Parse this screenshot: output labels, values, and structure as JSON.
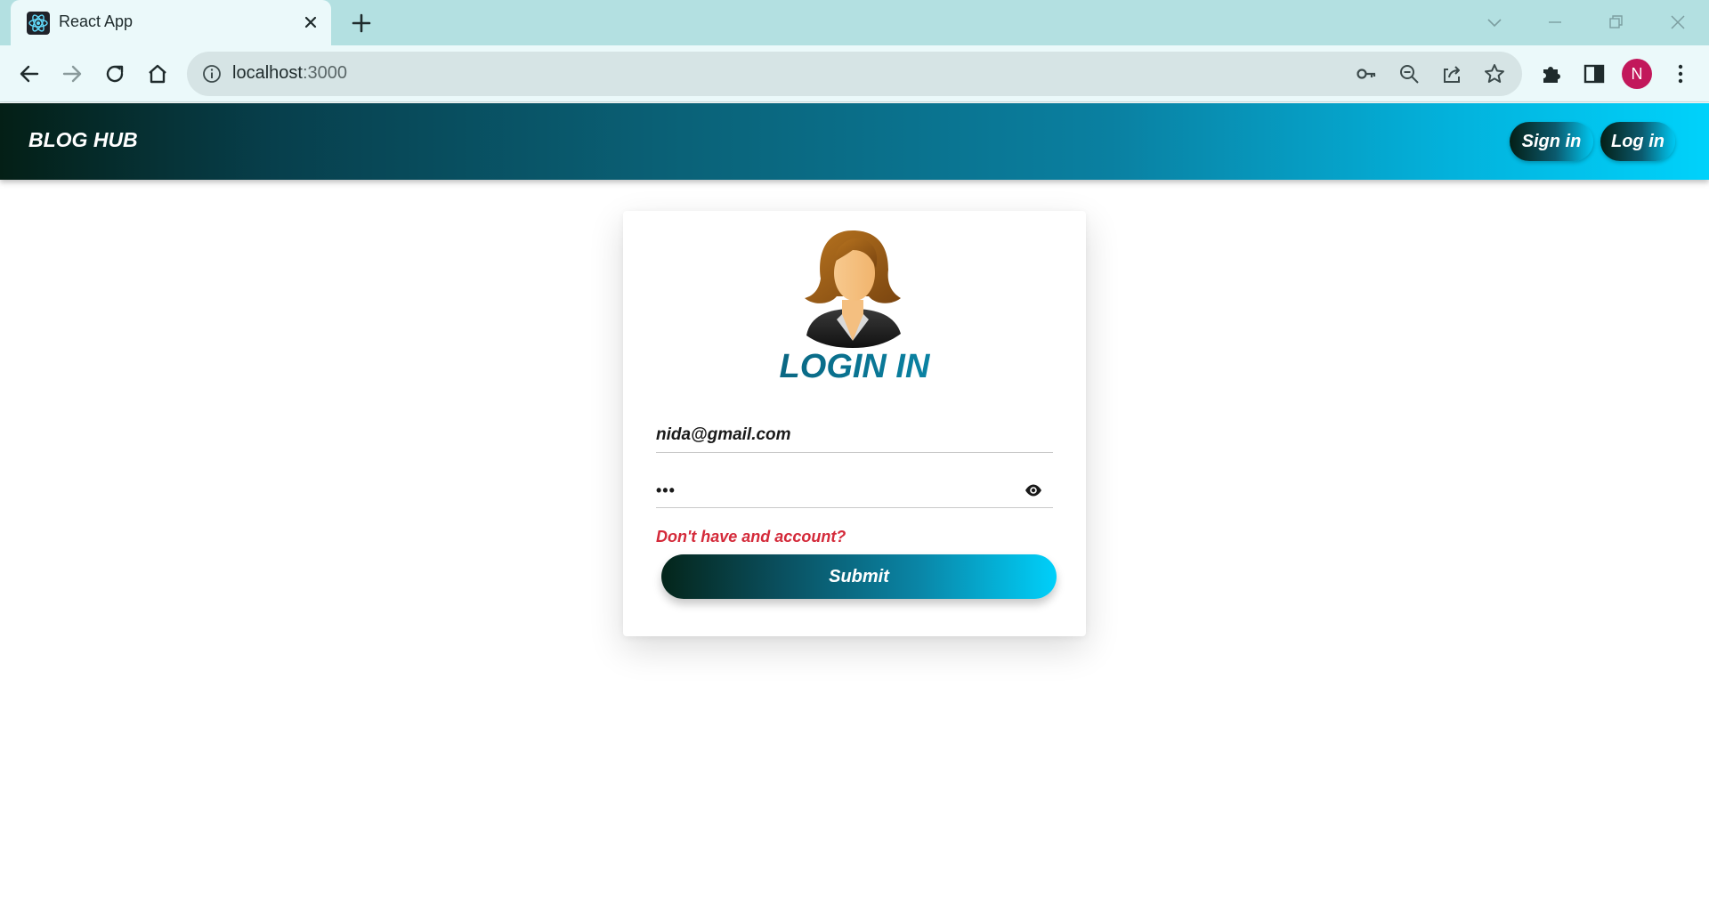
{
  "browser": {
    "tab_title": "React App",
    "url_host": "localhost",
    "url_port": ":3000",
    "profile_initial": "N",
    "profile_color": "#c2185b"
  },
  "app": {
    "brand": "BLOG HUB",
    "nav": {
      "sign_in": "Sign in",
      "log_in": "Log in"
    }
  },
  "login": {
    "title": "LOGIN IN",
    "email_value": "nida@gmail.com",
    "password_value": "•••",
    "signup_link": "Don't have and account?",
    "submit_label": "Submit"
  },
  "colors": {
    "header_gradient_start": "#041f16",
    "header_gradient_end": "#00d2fb",
    "link_red": "#d42a3a",
    "title_teal": "#0a7391"
  },
  "icons": {
    "tab": [
      "react-favicon-icon",
      "close-icon",
      "plus-icon"
    ],
    "window": [
      "chevron-down-icon",
      "minimize-icon",
      "restore-icon",
      "close-window-icon"
    ],
    "toolbar": [
      "back-arrow-icon",
      "forward-arrow-icon",
      "reload-icon",
      "home-icon",
      "info-icon",
      "key-icon",
      "zoom-out-icon",
      "share-icon",
      "star-icon",
      "puzzle-icon",
      "sidepanel-icon",
      "kebab-menu-icon"
    ],
    "form": [
      "eye-icon"
    ]
  }
}
